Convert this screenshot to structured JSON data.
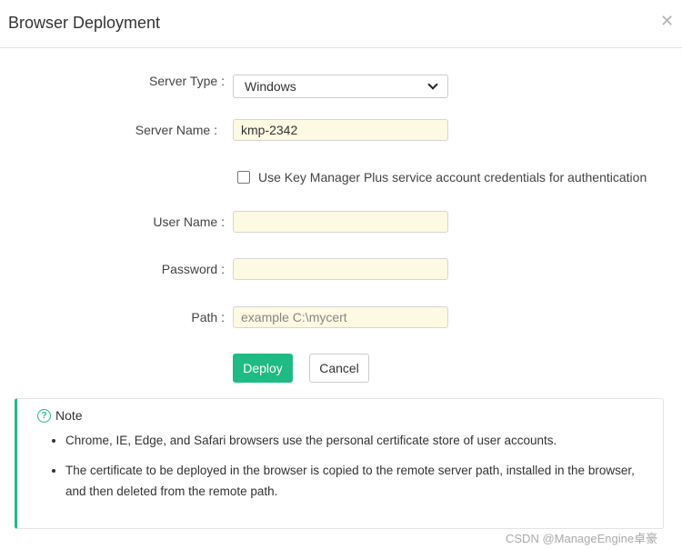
{
  "dialog": {
    "title": "Browser Deployment",
    "close_icon": "close-icon"
  },
  "form": {
    "server_type": {
      "label": "Server Type :",
      "value": "Windows"
    },
    "server_name": {
      "label": "Server Name :",
      "value": "kmp-2342"
    },
    "use_service_account": {
      "label": "Use Key Manager Plus service account credentials for authentication",
      "checked": false
    },
    "user_name": {
      "label": "User Name :",
      "value": ""
    },
    "password": {
      "label": "Password :",
      "value": ""
    },
    "path": {
      "label": "Path :",
      "value": "",
      "placeholder": "example C:\\mycert"
    }
  },
  "buttons": {
    "deploy": "Deploy",
    "cancel": "Cancel"
  },
  "note": {
    "icon": "question-circle-icon",
    "heading": "Note",
    "items": [
      "Chrome, IE, Edge, and Safari browsers use the personal certificate store of user accounts.",
      "The certificate to be deployed in the browser is copied to the remote server path, installed in the browser, and then deleted from the remote path."
    ]
  },
  "watermark": "CSDN @ManageEngine卓豪",
  "colors": {
    "accent": "#1fbb85",
    "input_bg": "#fdf9e2"
  }
}
